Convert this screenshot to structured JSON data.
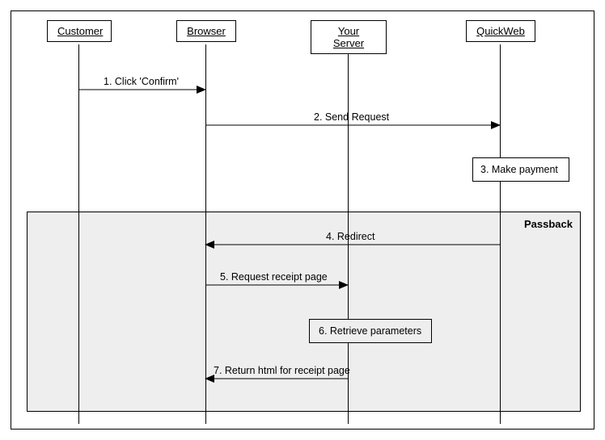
{
  "actors": {
    "customer": "Customer",
    "browser": "Browser",
    "server": "Your Server",
    "quickweb": "QuickWeb"
  },
  "passback_label": "Passback",
  "messages": {
    "m1": "1. Click 'Confirm'",
    "m2": "2. Send Request",
    "m3": "3. Make payment",
    "m4": "4. Redirect",
    "m5": "5. Request receipt page",
    "m6": "6. Retrieve parameters",
    "m7": "7. Return html for receipt page"
  },
  "chart_data": {
    "type": "sequence-diagram",
    "participants": [
      "Customer",
      "Browser",
      "Your Server",
      "QuickWeb"
    ],
    "fragments": [
      {
        "name": "Passback",
        "covers_messages": [
          4,
          5,
          6,
          7
        ]
      }
    ],
    "messages": [
      {
        "n": 1,
        "from": "Customer",
        "to": "Browser",
        "label": "Click 'Confirm'"
      },
      {
        "n": 2,
        "from": "Browser",
        "to": "QuickWeb",
        "label": "Send Request"
      },
      {
        "n": 3,
        "from": "QuickWeb",
        "to": "QuickWeb",
        "label": "Make payment",
        "self": true
      },
      {
        "n": 4,
        "from": "QuickWeb",
        "to": "Browser",
        "label": "Redirect",
        "fragment": "Passback"
      },
      {
        "n": 5,
        "from": "Browser",
        "to": "Your Server",
        "label": "Request receipt page",
        "fragment": "Passback"
      },
      {
        "n": 6,
        "from": "Your Server",
        "to": "Your Server",
        "label": "Retrieve parameters",
        "self": true,
        "fragment": "Passback"
      },
      {
        "n": 7,
        "from": "Your Server",
        "to": "Browser",
        "label": "Return html for receipt page",
        "fragment": "Passback"
      }
    ]
  }
}
